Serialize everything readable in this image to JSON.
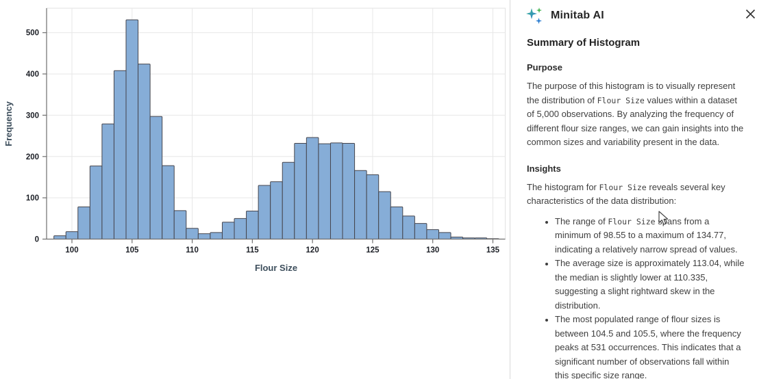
{
  "chart_data": {
    "type": "bar",
    "subtype": "histogram",
    "title": "",
    "xlabel": "Flour Size",
    "ylabel": "Frequency",
    "bin_width": 1,
    "bin_centers": [
      99,
      100,
      101,
      102,
      103,
      104,
      105,
      106,
      107,
      108,
      109,
      110,
      111,
      112,
      113,
      114,
      115,
      116,
      117,
      118,
      119,
      120,
      121,
      122,
      123,
      124,
      125,
      126,
      127,
      128,
      129,
      130,
      131,
      132,
      133,
      134,
      135
    ],
    "frequencies": [
      8,
      18,
      78,
      177,
      279,
      408,
      531,
      424,
      297,
      178,
      69,
      26,
      13,
      16,
      41,
      50,
      68,
      130,
      139,
      186,
      232,
      246,
      231,
      233,
      232,
      166,
      156,
      115,
      78,
      56,
      38,
      23,
      16,
      5,
      3,
      3,
      1
    ],
    "x_ticks": [
      100,
      105,
      110,
      115,
      120,
      125,
      130,
      135
    ],
    "y_ticks": [
      0,
      100,
      200,
      300,
      400,
      500
    ],
    "xlim": [
      97.9,
      136.1
    ],
    "ylim": [
      0,
      559
    ],
    "grid": true,
    "legend": false,
    "bar_fill": "#86add7",
    "bar_stroke": "#45454d",
    "grid_color": "#e7e7e7",
    "axis_color": "#6f6f6f",
    "plot_border_color": "#e2e2e2"
  },
  "panel": {
    "header": {
      "title": "Minitab AI",
      "icons": {
        "sparkle": "sparkle-icon",
        "close": "close-icon"
      }
    },
    "sections": {
      "summary_heading": "Summary of Histogram",
      "purpose_heading": "Purpose",
      "purpose_text": "The purpose of this histogram is to visually represent\nthe distribution of `Flour Size` values within a dataset\nof 5,000 observations. By analyzing the frequency of\ndifferent flour size ranges, we can gain insights into the\ncommon sizes and variability present in the data.",
      "insights_heading": "Insights",
      "insights_intro": "The histogram for `Flour Size` reveals several key\ncharacteristics of the data distribution:",
      "bullets": [
        "The range of `Flour Size` spans from a\nminimum of 98.55 to a maximum of 134.77,\nindicating a relatively narrow spread of values.",
        "The average size is approximately 113.04, while\nthe median is slightly lower at 110.335,\nsuggesting a slight rightward skew in the\ndistribution.",
        "The most populated range of flour sizes is\nbetween 104.5 and 105.5, where the frequency\npeaks at 531 occurrences. This indicates that a\nsignificant number of observations fall within\nthis specific size range."
      ]
    },
    "stats": {
      "observations": "5,000",
      "min": "98.55",
      "max": "134.77",
      "mean": "113.04",
      "median": "110.335",
      "peak_bin": "104.5 and 105.5",
      "peak_frequency": "531"
    }
  },
  "colors": {
    "sparkle_teal": "#2fb59b",
    "sparkle_green": "#47b655",
    "sparkle_blue": "#2f7fd1",
    "close_icon": "#333333",
    "divider": "#d8d8d8"
  }
}
